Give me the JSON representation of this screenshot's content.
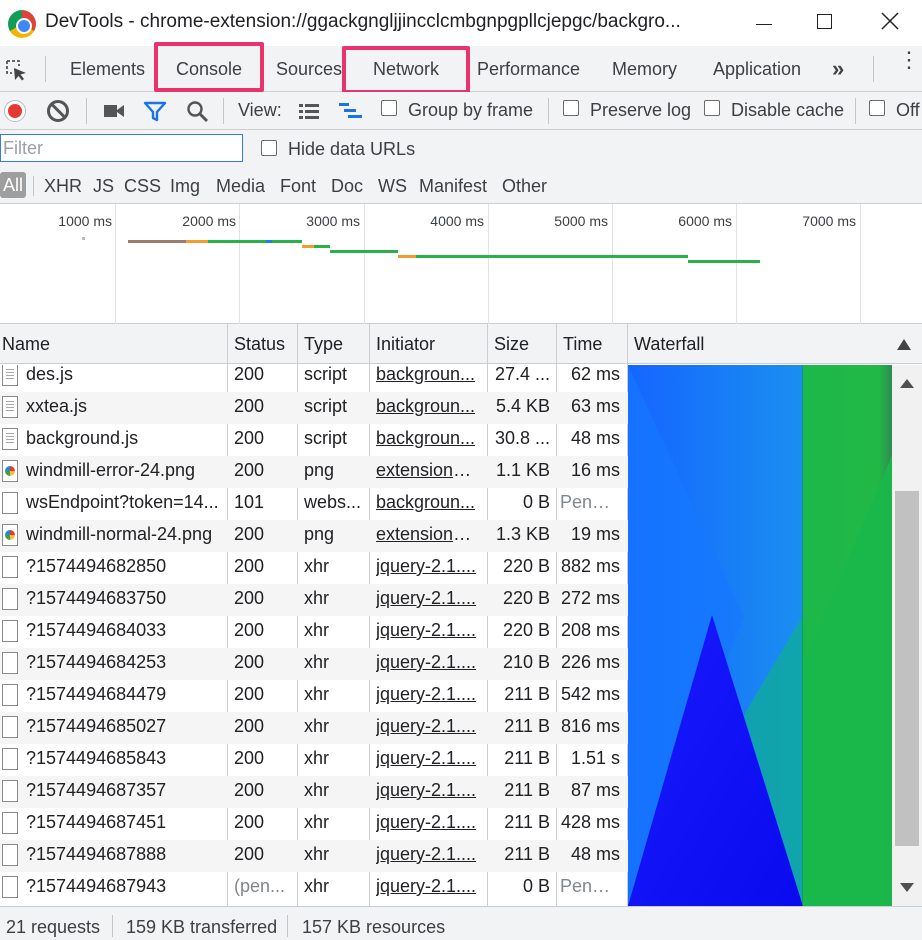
{
  "window": {
    "title": "DevTools - chrome-extension://ggackgngljjincclcmbgnpgpllcjepgc/backgro..."
  },
  "tabs": [
    "Elements",
    "Console",
    "Sources",
    "Network",
    "Performance",
    "Memory",
    "Application"
  ],
  "highlighted_tabs": [
    "Console",
    "Network"
  ],
  "toolbar": {
    "view_label": "View:",
    "group_by_frame": "Group by frame",
    "preserve_log": "Preserve log",
    "disable_cache": "Disable cache",
    "offline": "Off"
  },
  "filter": {
    "placeholder": "Filter",
    "hide_data_urls": "Hide data URLs"
  },
  "types": [
    "All",
    "XHR",
    "JS",
    "CSS",
    "Img",
    "Media",
    "Font",
    "Doc",
    "WS",
    "Manifest",
    "Other"
  ],
  "overview": {
    "ticks": [
      "1000 ms",
      "2000 ms",
      "3000 ms",
      "4000 ms",
      "5000 ms",
      "6000 ms",
      "7000 ms"
    ]
  },
  "columns": [
    "Name",
    "Status",
    "Type",
    "Initiator",
    "Size",
    "Time",
    "Waterfall"
  ],
  "rows": [
    {
      "name": "des.js",
      "status": "200",
      "type": "script",
      "initiator": "backgroun...",
      "size": "27.4 ...",
      "time": "62 ms",
      "icon": "script-file-icon"
    },
    {
      "name": "xxtea.js",
      "status": "200",
      "type": "script",
      "initiator": "backgroun...",
      "size": "5.4 KB",
      "time": "63 ms",
      "icon": "script-file-icon"
    },
    {
      "name": "background.js",
      "status": "200",
      "type": "script",
      "initiator": "backgroun...",
      "size": "30.8 ...",
      "time": "48 ms",
      "icon": "script-file-icon"
    },
    {
      "name": "windmill-error-24.png",
      "status": "200",
      "type": "png",
      "initiator": "extensions:...",
      "size": "1.1 KB",
      "time": "16 ms",
      "icon": "image-file-icon"
    },
    {
      "name": "wsEndpoint?token=14...",
      "status": "101",
      "type": "webs...",
      "initiator": "backgroun...",
      "size": "0 B",
      "time": "Pendi...",
      "icon": "blank-file-icon"
    },
    {
      "name": "windmill-normal-24.png",
      "status": "200",
      "type": "png",
      "initiator": "extensions:...",
      "size": "1.3 KB",
      "time": "19 ms",
      "icon": "image-file-icon"
    },
    {
      "name": "?1574494682850",
      "status": "200",
      "type": "xhr",
      "initiator": "jquery-2.1....",
      "size": "220 B",
      "time": "882 ms",
      "icon": "blank-file-icon"
    },
    {
      "name": "?1574494683750",
      "status": "200",
      "type": "xhr",
      "initiator": "jquery-2.1....",
      "size": "220 B",
      "time": "272 ms",
      "icon": "blank-file-icon"
    },
    {
      "name": "?1574494684033",
      "status": "200",
      "type": "xhr",
      "initiator": "jquery-2.1....",
      "size": "220 B",
      "time": "208 ms",
      "icon": "blank-file-icon"
    },
    {
      "name": "?1574494684253",
      "status": "200",
      "type": "xhr",
      "initiator": "jquery-2.1....",
      "size": "210 B",
      "time": "226 ms",
      "icon": "blank-file-icon"
    },
    {
      "name": "?1574494684479",
      "status": "200",
      "type": "xhr",
      "initiator": "jquery-2.1....",
      "size": "211 B",
      "time": "542 ms",
      "icon": "blank-file-icon"
    },
    {
      "name": "?1574494685027",
      "status": "200",
      "type": "xhr",
      "initiator": "jquery-2.1....",
      "size": "211 B",
      "time": "816 ms",
      "icon": "blank-file-icon"
    },
    {
      "name": "?1574494685843",
      "status": "200",
      "type": "xhr",
      "initiator": "jquery-2.1....",
      "size": "211 B",
      "time": "1.51 s",
      "icon": "blank-file-icon"
    },
    {
      "name": "?1574494687357",
      "status": "200",
      "type": "xhr",
      "initiator": "jquery-2.1....",
      "size": "211 B",
      "time": "87 ms",
      "icon": "blank-file-icon"
    },
    {
      "name": "?1574494687451",
      "status": "200",
      "type": "xhr",
      "initiator": "jquery-2.1....",
      "size": "211 B",
      "time": "428 ms",
      "icon": "blank-file-icon"
    },
    {
      "name": "?1574494687888",
      "status": "200",
      "type": "xhr",
      "initiator": "jquery-2.1....",
      "size": "211 B",
      "time": "48 ms",
      "icon": "blank-file-icon"
    },
    {
      "name": "?1574494687943",
      "status": "(pen...",
      "type": "xhr",
      "initiator": "jquery-2.1....",
      "size": "0 B",
      "time": "Pendi...",
      "icon": "blank-file-icon",
      "pending": true
    }
  ],
  "statusbar": {
    "requests": "21 requests",
    "transferred": "159 KB transferred",
    "resources": "157 KB resources"
  },
  "colors": {
    "highlight": "#e8336d",
    "record": "#e53935",
    "filter_active": "#1a73e8",
    "waiting_green": "#27b34a",
    "content_blue": "#1a7ff0"
  }
}
